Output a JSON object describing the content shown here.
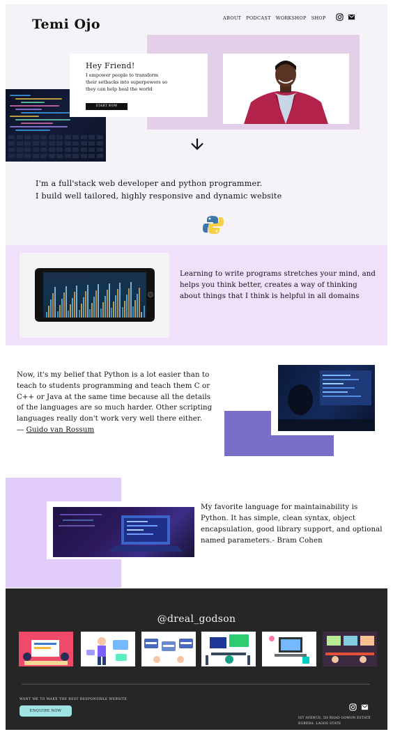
{
  "site": {
    "name": "Temi Ojo",
    "nav": [
      "ABOUT",
      "PODCAST",
      "WORKSHOP",
      "SHOP"
    ],
    "nav_icons": [
      "instagram-icon",
      "email-icon"
    ]
  },
  "hero": {
    "title": "Hey Friend!",
    "text": "I empower people to transform their setbacks into superpowers so they can help heal the world",
    "button": "START NOW"
  },
  "intro": {
    "line1": "I'm a full'stack web developer and python programmer.",
    "line2": "I build well tailored, highly responsive and dynamic website"
  },
  "section2": {
    "text": "Learning to write programs stretches your mind, and helps you think better, creates a way of thinking about things that I think is helpful in all domains"
  },
  "section3": {
    "quote": "Now, it's my belief that Python is a lot easier than to teach to students programming and teach them C or C++ or Java at the same time because all the details of the languages are so much harder. Other scripting languages really don't work very well there either.",
    "dash": "— ",
    "author": "Guido van Rossum"
  },
  "section4": {
    "quote": "My favorite language for maintainability is Python. It has simple, clean syntax, object encapsulation, good library support, and optional named parameters.- Bram Cohen"
  },
  "footer": {
    "handle": "@dreal_godson",
    "cta_text": "WANT ME TO MAKE THE BEST RESPONSIBLE WEBSITE",
    "button": "ENQUIRE NOW",
    "address_line1": "IST AVENUE, 5H ROAD GOWON ESTATE",
    "address_line2": "EGBEDA, LAGOS STATE",
    "icons": [
      "instagram-icon",
      "email-icon"
    ]
  },
  "colors": {
    "hero_bg": "#f6f3f8",
    "lilac": "#e3cfe8",
    "section2_bg": "#efe0fb",
    "violet_block": "#7a6fc6",
    "section4_lilac": "#e2ccfa",
    "footer_bg": "#262626",
    "enquire_button": "#9fe3e2"
  }
}
